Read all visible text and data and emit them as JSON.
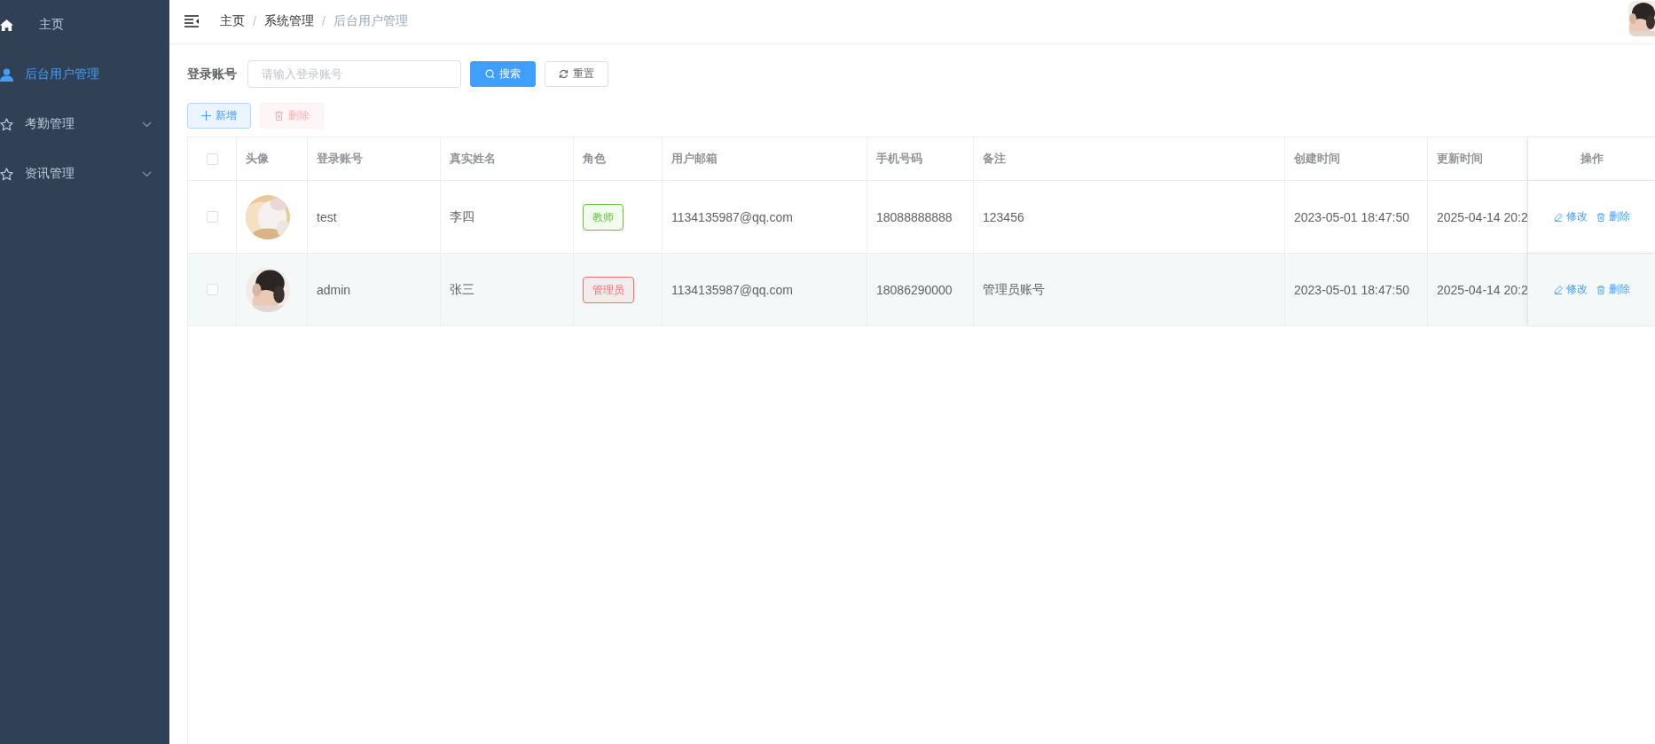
{
  "sidebar": {
    "items": [
      {
        "label": "主页",
        "kind": "home",
        "selected": false,
        "expandable": false
      },
      {
        "label": "后台用户管理",
        "kind": "user",
        "selected": true,
        "expandable": false
      },
      {
        "label": "考勤管理",
        "kind": "star",
        "selected": false,
        "expandable": true
      },
      {
        "label": "资讯管理",
        "kind": "star",
        "selected": false,
        "expandable": true
      }
    ]
  },
  "breadcrumb": [
    {
      "label": "主页",
      "current": false
    },
    {
      "separator": "/",
      "label": "系统管理",
      "current": false
    },
    {
      "separator": "/",
      "label": "后台用户管理",
      "current": true
    }
  ],
  "header": {
    "avatar": {
      "kind": "picture"
    }
  },
  "search": {
    "label": "登录账号",
    "placeholder": "请输入登录账号",
    "search_button": "搜索",
    "reset_button": "重置"
  },
  "toolbar": {
    "add_button": "新增",
    "delete_button": {
      "label": "删除",
      "disabled": true
    }
  },
  "table": {
    "select_all_checked": false,
    "columns": [
      "头像",
      "登录账号",
      "真实姓名",
      "角色",
      "用户邮箱",
      "手机号码",
      "备注",
      "创建时间",
      "更新时间",
      "操作"
    ],
    "rows": [
      {
        "checked": false,
        "highlighted": false,
        "avatar": {
          "kind": "picture"
        },
        "account": "test",
        "name": "李四",
        "role": {
          "label": "教师",
          "color": "#67c23a"
        },
        "email": "1134135987@qq.com",
        "phone": "18088888888",
        "remark": "123456",
        "created": "2023-05-01 18:47:50",
        "updated": "2025-04-14 20:2",
        "actions": [
          "修改",
          "删除"
        ]
      },
      {
        "checked": false,
        "highlighted": true,
        "avatar": {
          "kind": "picture"
        },
        "account": "admin",
        "name": "张三",
        "role": {
          "label": "管理员",
          "color": "#f56c6c"
        },
        "email": "1134135987@qq.com",
        "phone": "18086290000",
        "remark": "管理员账号",
        "created": "2023-05-01 18:47:50",
        "updated": "2025-04-14 20:2",
        "actions": [
          "修改",
          "删除"
        ]
      }
    ]
  }
}
